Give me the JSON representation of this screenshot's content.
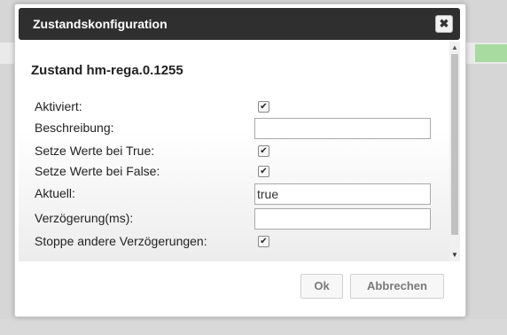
{
  "dialog": {
    "title": "Zustandskonfiguration",
    "close_symbol": "✖",
    "heading": "Zustand hm-rega.0.1255"
  },
  "fields": {
    "aktiviert": {
      "label": "Aktiviert:",
      "checked": true
    },
    "beschreibung": {
      "label": "Beschreibung:",
      "value": ""
    },
    "setze_true": {
      "label": "Setze Werte bei True:",
      "checked": true
    },
    "setze_false": {
      "label": "Setze Werte bei False:",
      "checked": true
    },
    "aktuell": {
      "label": "Aktuell:",
      "value": "true"
    },
    "verzoegerung": {
      "label": "Verzögerung(ms):",
      "value": ""
    },
    "stoppe": {
      "label": "Stoppe andere Verzögerungen:",
      "checked": true
    }
  },
  "check_mark": "✔",
  "buttons": {
    "ok": "Ok",
    "cancel": "Abbrechen"
  },
  "icons": {
    "close": "close-icon",
    "scroll_up": "triangle-up-icon",
    "scroll_down": "triangle-down-icon"
  },
  "colors": {
    "titlebar": "#2f2f2f",
    "accent_green": "#a8dba0"
  }
}
